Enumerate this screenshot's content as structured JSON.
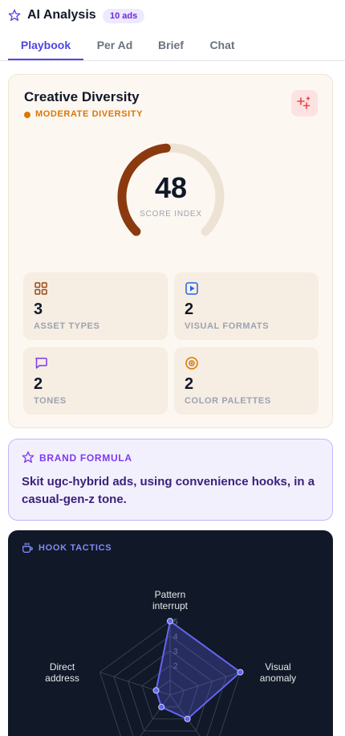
{
  "header": {
    "title": "AI Analysis",
    "ads_badge": "10 ads"
  },
  "tabs": [
    {
      "label": "Playbook",
      "active": true
    },
    {
      "label": "Per Ad",
      "active": false
    },
    {
      "label": "Brief",
      "active": false
    },
    {
      "label": "Chat",
      "active": false
    }
  ],
  "diversity": {
    "title": "Creative Diversity",
    "level": "MODERATE DIVERSITY",
    "score": "48",
    "score_max": 100,
    "score_label": "SCORE INDEX",
    "stats": [
      {
        "icon": "grid-icon",
        "value": "3",
        "label": "ASSET TYPES"
      },
      {
        "icon": "play-icon",
        "value": "2",
        "label": "VISUAL FORMATS"
      },
      {
        "icon": "chat-bubble-icon",
        "value": "2",
        "label": "TONES"
      },
      {
        "icon": "palette-icon",
        "value": "2",
        "label": "COLOR PALETTES"
      }
    ]
  },
  "brand_formula": {
    "title": "BRAND FORMULA",
    "text": "Skit ugc-hybrid ads, using convenience hooks, in a casual-gen-z tone."
  },
  "hook_tactics": {
    "title": "HOOK TACTICS",
    "axes": [
      {
        "label": "Pattern\ninterrupt",
        "value": 5
      },
      {
        "label": "Visual\nanomaly",
        "value": 5
      },
      {
        "label": "",
        "value": 2
      },
      {
        "label": "",
        "value": 1
      },
      {
        "label": "Direct\naddress",
        "value": 1
      }
    ],
    "scale_ticks": [
      "2",
      "3",
      "4",
      "5"
    ],
    "max": 5
  },
  "colors": {
    "accent": "#4f46e5",
    "gauge_fill": "#8b3a0f",
    "gauge_track": "#ede3d4",
    "radar_fill": "#6366f1"
  }
}
